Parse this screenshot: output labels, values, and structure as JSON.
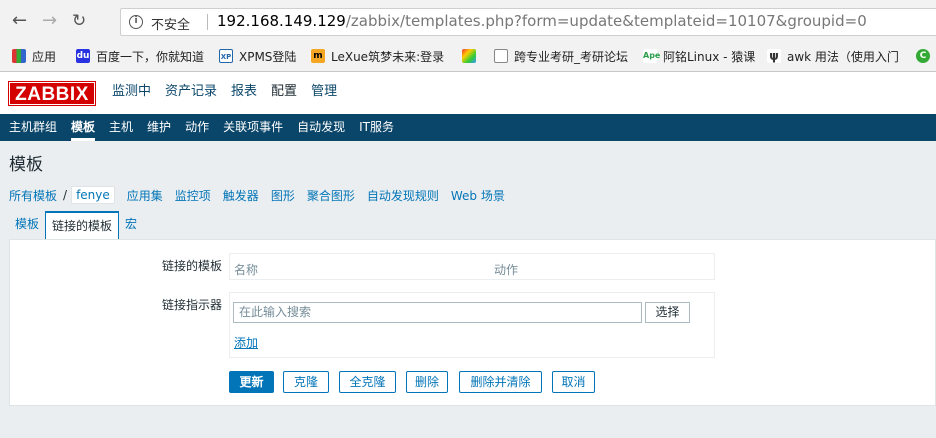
{
  "browser": {
    "security_label": "不安全",
    "url_host": "192.168.149.129",
    "url_path": "/zabbix/templates.php?form=update&templateid=10107&groupid=0",
    "bookmarks": [
      {
        "label": "应用",
        "icon": "apps-grid-icon"
      },
      {
        "label": "百度一下，你就知道",
        "icon": "baidu-icon"
      },
      {
        "label": "XPMS登陆",
        "icon": "xpms-icon"
      },
      {
        "label": "LeXue筑梦未来:登录",
        "icon": "lexue-icon"
      },
      {
        "label": "",
        "icon": "colorful-app-icon"
      },
      {
        "label": "跨专业考研_考研论坛",
        "icon": "page-icon"
      },
      {
        "label": "阿铭Linux - 猿课",
        "icon": "apelearn-icon"
      },
      {
        "label": "awk 用法（使用入门",
        "icon": "blog-icon"
      }
    ]
  },
  "zabbix": {
    "logo": "ZABBIX",
    "main_menu": [
      "监测中",
      "资产记录",
      "报表",
      "配置",
      "管理"
    ],
    "main_menu_active": "配置",
    "sub_menu": [
      "主机群组",
      "模板",
      "主机",
      "维护",
      "动作",
      "关联项事件",
      "自动发现",
      "IT服务"
    ],
    "sub_menu_active": "模板",
    "page_title": "模板",
    "breadcrumb": {
      "all_templates": "所有模板",
      "separator": "/",
      "current": "fenye",
      "links": [
        "应用集",
        "监控项",
        "触发器",
        "图形",
        "聚合图形",
        "自动发现规则",
        "Web 场景"
      ]
    },
    "tabs": [
      "模板",
      "链接的模板",
      "宏"
    ],
    "tab_active": "链接的模板",
    "form": {
      "linked_templates_label": "链接的模板",
      "col_name": "名称",
      "col_action": "动作",
      "link_indicator_label": "链接指示器",
      "search_placeholder": "在此输入搜索",
      "select_button": "选择",
      "add_link": "添加"
    },
    "buttons": {
      "update": "更新",
      "clone": "克隆",
      "full_clone": "全克隆",
      "delete": "删除",
      "delete_and_clear": "删除并清除",
      "cancel": "取消"
    }
  },
  "colors": {
    "brand_red": "#d40000",
    "nav_dark_blue": "#0a466a",
    "link_blue": "#0275b8"
  }
}
